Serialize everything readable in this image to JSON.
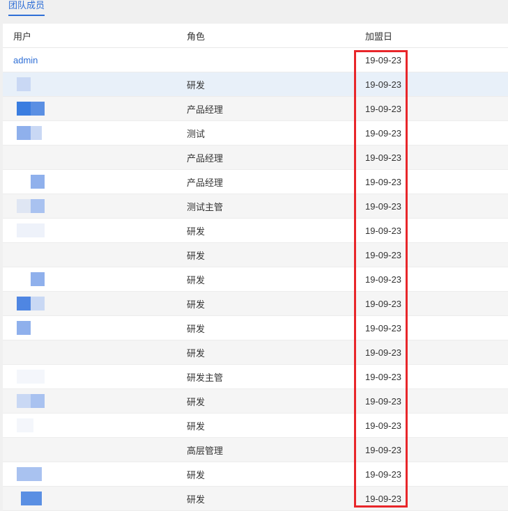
{
  "tabs": [
    {
      "label": "团队成员",
      "active": true
    }
  ],
  "table": {
    "columns": {
      "user": "用户",
      "role": "角色",
      "joined": "加盟日"
    },
    "rows": [
      {
        "user": "admin",
        "role": "",
        "joined": "19-09-23"
      },
      {
        "user": "",
        "role": "研发",
        "joined": "19-09-23"
      },
      {
        "user": "",
        "role": "产品经理",
        "joined": "19-09-23"
      },
      {
        "user": "",
        "role": "测试",
        "joined": "19-09-23"
      },
      {
        "user": "",
        "role": "产品经理",
        "joined": "19-09-23"
      },
      {
        "user": "",
        "role": "产品经理",
        "joined": "19-09-23"
      },
      {
        "user": "",
        "role": "测试主管",
        "joined": "19-09-23"
      },
      {
        "user": "",
        "role": "研发",
        "joined": "19-09-23"
      },
      {
        "user": "",
        "role": "研发",
        "joined": "19-09-23"
      },
      {
        "user": "",
        "role": "研发",
        "joined": "19-09-23"
      },
      {
        "user": "",
        "role": "研发",
        "joined": "19-09-23"
      },
      {
        "user": "",
        "role": "研发",
        "joined": "19-09-23"
      },
      {
        "user": "",
        "role": "研发",
        "joined": "19-09-23"
      },
      {
        "user": "",
        "role": "研发主管",
        "joined": "19-09-23"
      },
      {
        "user": "",
        "role": "研发",
        "joined": "19-09-23"
      },
      {
        "user": "",
        "role": "研发",
        "joined": "19-09-23"
      },
      {
        "user": "",
        "role": "高层管理",
        "joined": "19-09-23"
      },
      {
        "user": "",
        "role": "研发",
        "joined": "19-09-23"
      },
      {
        "user": "",
        "role": "研发",
        "joined": "19-09-23"
      }
    ]
  },
  "colors": {
    "accent": "#2f6fd6",
    "highlight": "#e8262a",
    "row_alt": "#f5f5f5",
    "row_hover": "#e8f0f9",
    "avatar_blur": [
      "#3a7de0",
      "#8fb0ec",
      "#a9c2f0",
      "#c9d8f4"
    ]
  }
}
